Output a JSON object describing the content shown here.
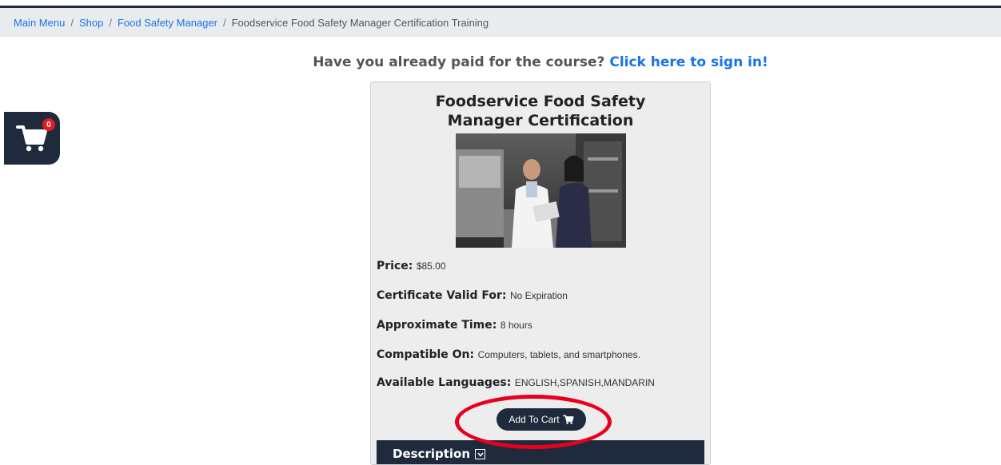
{
  "breadcrumb": {
    "items": [
      "Main Menu",
      "Shop",
      "Food Safety Manager"
    ],
    "current": "Foodservice Food Safety Manager Certification Training",
    "separator": "/"
  },
  "signin": {
    "prompt": "Have you already paid for the course?",
    "link": "Click here to sign in!"
  },
  "cart": {
    "count": "0",
    "icon": "shopping-cart-icon"
  },
  "course": {
    "title": "Foodservice Food Safety Manager Certification Training",
    "image_alt": "Two food safety professionals reviewing a clipboard in a commercial kitchen",
    "price_label": "Price:",
    "price_value": "$85.00",
    "valid_label": "Certificate Valid For:",
    "valid_value": "No Expiration",
    "time_label": "Approximate Time:",
    "time_value": "8 hours",
    "compatible_label": "Compatible On:",
    "compatible_value": "Computers, tablets, and smartphones.",
    "languages_label": "Available Languages:",
    "languages_value": "ENGLISH,SPANISH,MANDARIN",
    "add_to_cart": "Add To Cart",
    "description_label": "Description"
  },
  "colors": {
    "navy": "#1f2a3c",
    "link": "#1a73e8",
    "highlight": "#e8001c",
    "badge": "#e31b23"
  }
}
